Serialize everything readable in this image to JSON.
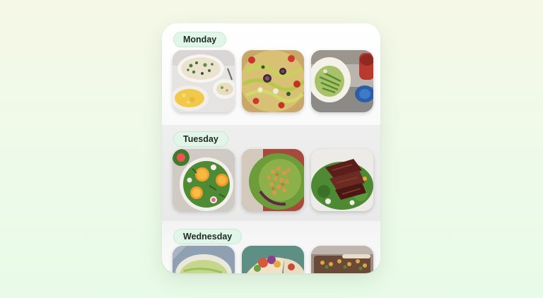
{
  "days": [
    {
      "label": "Monday",
      "meals": [
        {
          "icon": "rice-salad-bowls-photo"
        },
        {
          "icon": "zucchini-noodles-photo"
        },
        {
          "icon": "green-bean-plate-photo"
        }
      ]
    },
    {
      "label": "Tuesday",
      "meals": [
        {
          "icon": "orange-radish-salad-photo"
        },
        {
          "icon": "roasted-chickpea-salad-photo"
        },
        {
          "icon": "steak-salad-photo"
        }
      ]
    },
    {
      "label": "Wednesday",
      "meals": [
        {
          "icon": "slaw-bowl-photo"
        },
        {
          "icon": "veggie-wrap-photo"
        },
        {
          "icon": "grain-tray-photo"
        }
      ]
    }
  ],
  "colors": {
    "pill_background": "#e2f5e9",
    "pill_border": "#c8e9d3",
    "card_background": "#ffffff"
  }
}
